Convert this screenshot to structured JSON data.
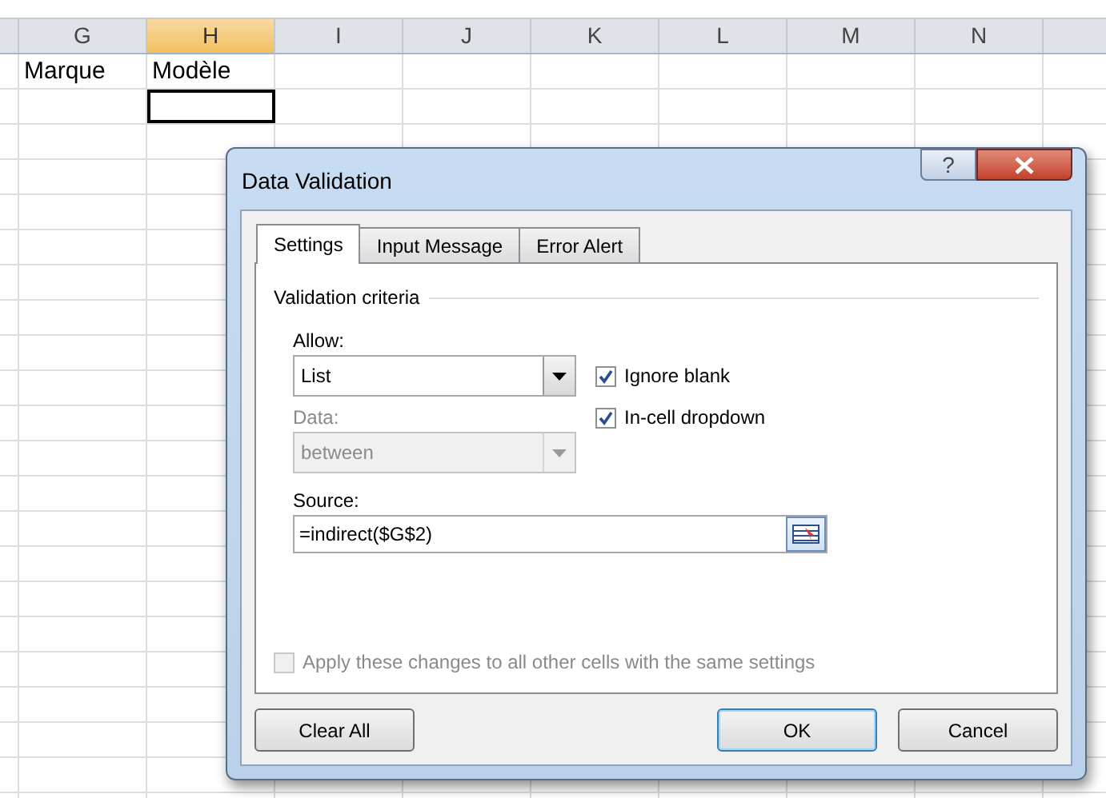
{
  "sheet": {
    "columns": [
      {
        "label": "G",
        "selected": false
      },
      {
        "label": "H",
        "selected": true
      },
      {
        "label": "I",
        "selected": false
      },
      {
        "label": "J",
        "selected": false
      },
      {
        "label": "K",
        "selected": false
      },
      {
        "label": "L",
        "selected": false
      },
      {
        "label": "M",
        "selected": false
      },
      {
        "label": "N",
        "selected": false
      }
    ],
    "rows": [
      {
        "cells": [
          {
            "value": "Marque",
            "active": false
          },
          {
            "value": "Modèle",
            "active": false
          }
        ]
      },
      {
        "cells": [
          {
            "active": false
          },
          {
            "active": true
          }
        ]
      }
    ]
  },
  "dialog": {
    "title": "Data Validation",
    "help_button": "?",
    "tabs": [
      {
        "label": "Settings",
        "selected": true
      },
      {
        "label": "Input Message",
        "selected": false
      },
      {
        "label": "Error Alert",
        "selected": false
      }
    ],
    "section": "Validation criteria",
    "allow": {
      "label": "Allow:",
      "value": "List",
      "disabled": false
    },
    "data": {
      "label": "Data:",
      "value": "between",
      "disabled": true
    },
    "checkboxes": [
      {
        "label": "Ignore blank",
        "checked": true,
        "disabled": false
      },
      {
        "label": "In-cell dropdown",
        "checked": true,
        "disabled": false
      }
    ],
    "source": {
      "label": "Source:",
      "value": "=indirect($G$2)"
    },
    "apply_all": {
      "label": "Apply these changes to all other cells with the same settings",
      "checked": false,
      "disabled": true
    },
    "buttons": [
      {
        "label": "Clear All",
        "kind": "left",
        "default": false
      },
      {
        "label": "OK",
        "kind": "right",
        "default": true
      },
      {
        "label": "Cancel",
        "kind": "right",
        "default": false
      }
    ]
  }
}
